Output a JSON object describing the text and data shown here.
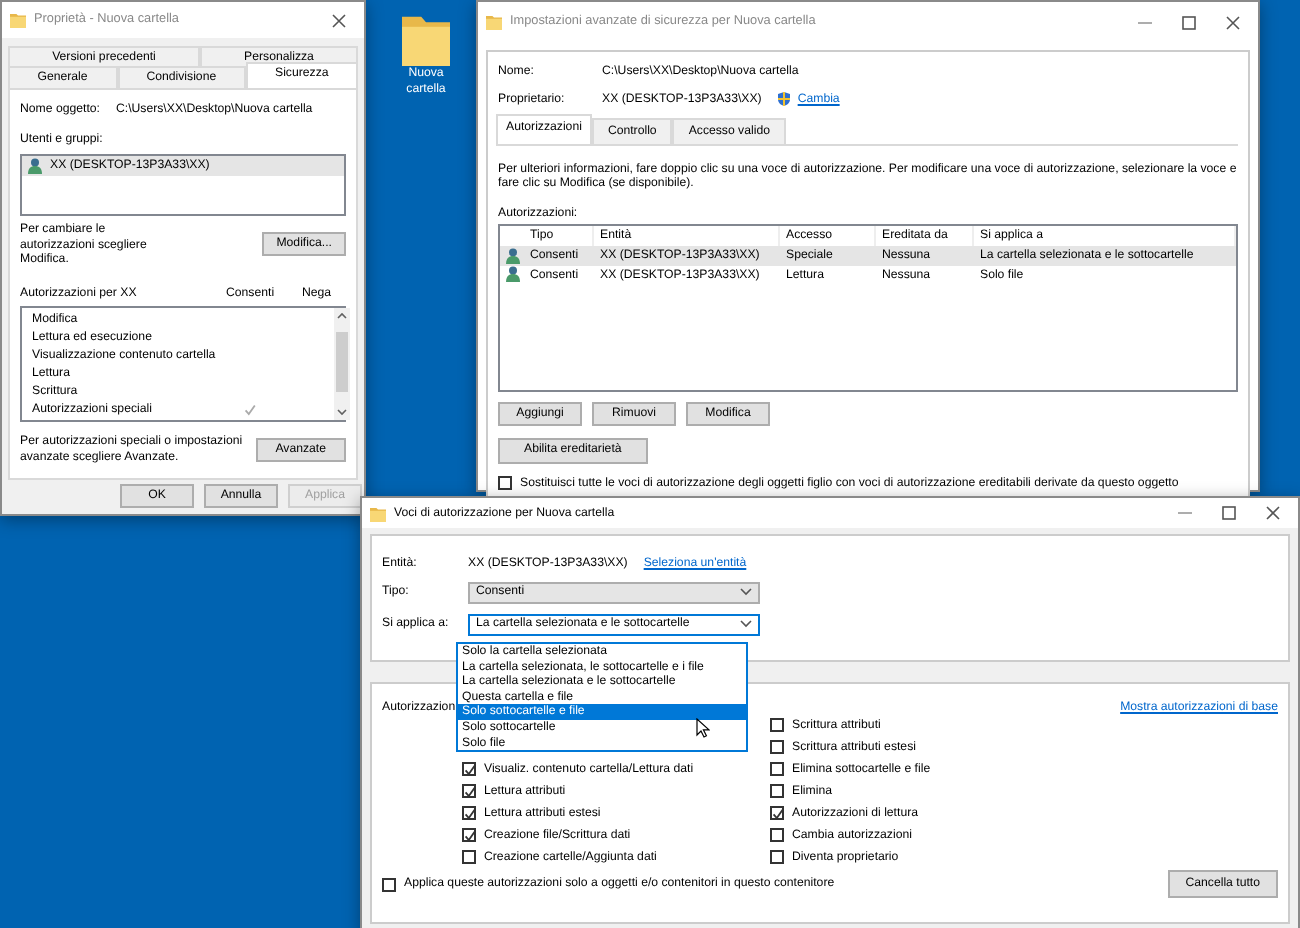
{
  "desktop": {
    "icon_label": "Nuova cartella"
  },
  "properties": {
    "title": "Proprietà - Nuova cartella",
    "tab_rows": [
      [
        {
          "label": "Versioni precedenti",
          "selected": false
        },
        {
          "label": "Personalizza",
          "selected": false
        }
      ],
      [
        {
          "label": "Generale",
          "selected": false
        },
        {
          "label": "Condivisione",
          "selected": false
        },
        {
          "label": "Sicurezza",
          "selected": true
        }
      ]
    ],
    "object_label": "Nome oggetto:",
    "object_path": "C:\\Users\\XX\\Desktop\\Nuova cartella",
    "users_label": "Utenti e gruppi:",
    "users": [
      {
        "name": "XX (DESKTOP-13P3A33\\XX)",
        "selected": true
      }
    ],
    "change_hint": "Per cambiare le autorizzazioni scegliere Modifica.",
    "modify_button": "Modifica...",
    "permissions_label": "Autorizzazioni per XX",
    "allow_header": "Consenti",
    "deny_header": "Nega",
    "permissions": [
      {
        "name": "Modifica",
        "allow": false
      },
      {
        "name": "Lettura ed esecuzione",
        "allow": false
      },
      {
        "name": "Visualizzazione contenuto cartella",
        "allow": false
      },
      {
        "name": "Lettura",
        "allow": false
      },
      {
        "name": "Scrittura",
        "allow": false
      },
      {
        "name": "Autorizzazioni speciali",
        "allow": true
      }
    ],
    "advanced_hint": "Per autorizzazioni speciali o impostazioni avanzate scegliere Avanzate.",
    "advanced_button": "Avanzate",
    "buttons": [
      {
        "label": "OK",
        "disabled": false
      },
      {
        "label": "Annulla",
        "disabled": false
      },
      {
        "label": "Applica",
        "disabled": true
      }
    ]
  },
  "advanced": {
    "title": "Impostazioni avanzate di sicurezza per Nuova cartella",
    "name_label": "Nome:",
    "name": "C:\\Users\\XX\\Desktop\\Nuova cartella",
    "owner_label": "Proprietario:",
    "owner": "XX (DESKTOP-13P3A33\\XX)",
    "change_link": "Cambia",
    "tabs": [
      {
        "label": "Autorizzazioni",
        "selected": true
      },
      {
        "label": "Controllo",
        "selected": false
      },
      {
        "label": "Accesso valido",
        "selected": false
      }
    ],
    "info": "Per ulteriori informazioni, fare doppio clic su una voce di autorizzazione. Per modificare una voce di autorizzazione, selezionare la voce e fare clic su Modifica (se disponibile).",
    "permissions_label": "Autorizzazioni:",
    "table": {
      "columns": [
        "Tipo",
        "Entità",
        "Accesso",
        "Ereditata da",
        "Si applica a"
      ],
      "rows": [
        {
          "cells": [
            "Consenti",
            "XX (DESKTOP-13P3A33\\XX)",
            "Speciale",
            "Nessuna",
            "La cartella selezionata e le sottocartelle"
          ],
          "selected": true
        },
        {
          "cells": [
            "Consenti",
            "XX (DESKTOP-13P3A33\\XX)",
            "Lettura",
            "Nessuna",
            "Solo file"
          ],
          "selected": false
        }
      ]
    },
    "buttons": [
      "Aggiungi",
      "Rimuovi",
      "Modifica"
    ],
    "inherit_button": "Abilita ereditarietà",
    "replace_option": {
      "label": "Sostituisci tutte le voci di autorizzazione degli oggetti figlio con voci di autorizzazione ereditabili derivate da questo oggetto",
      "checked": false
    }
  },
  "entry": {
    "title": "Voci di autorizzazione per Nuova cartella",
    "entity_label": "Entità:",
    "entity": "XX (DESKTOP-13P3A33\\XX)",
    "select_link": "Seleziona un'entità",
    "type_label": "Tipo:",
    "type_value": "Consenti",
    "applies_label": "Si applica a:",
    "applies_value": "La cartella selezionata e le sottocartelle",
    "applies_expanded": true,
    "applies_options": [
      {
        "label": "Solo la cartella selezionata",
        "selected": false
      },
      {
        "label": "La cartella selezionata, le sottocartelle e i file",
        "selected": false
      },
      {
        "label": "La cartella selezionata e le sottocartelle",
        "selected": false
      },
      {
        "label": "Questa cartella e file",
        "selected": false
      },
      {
        "label": "Solo sottocartelle e file",
        "selected": true
      },
      {
        "label": "Solo sottocartelle",
        "selected": false
      },
      {
        "label": "Solo file",
        "selected": false
      }
    ],
    "permissions_label": "Autorizzazion",
    "basic_link": "Mostra autorizzazioni di base",
    "left_permissions": [
      {
        "label": "Visualiz. contenuto cartella/Lettura dati",
        "checked": true
      },
      {
        "label": "Lettura attributi",
        "checked": true
      },
      {
        "label": "Lettura attributi estesi",
        "checked": true
      },
      {
        "label": "Creazione file/Scrittura dati",
        "checked": true
      },
      {
        "label": "Creazione cartelle/Aggiunta dati",
        "checked": false
      }
    ],
    "right_permissions": [
      {
        "label": "Scrittura attributi",
        "checked": false
      },
      {
        "label": "Scrittura attributi estesi",
        "checked": false
      },
      {
        "label": "Elimina sottocartelle e file",
        "checked": false
      },
      {
        "label": "Elimina",
        "checked": false
      },
      {
        "label": "Autorizzazioni di lettura",
        "checked": true
      },
      {
        "label": "Cambia autorizzazioni",
        "checked": false
      },
      {
        "label": "Diventa proprietario",
        "checked": false
      }
    ],
    "apply_only": {
      "label": "Applica queste autorizzazioni solo a oggetti e/o contenitori in questo contenitore",
      "checked": false
    },
    "clear_button": "Cancella tutto"
  }
}
